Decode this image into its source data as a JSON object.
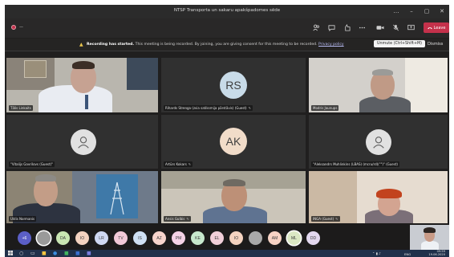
{
  "window": {
    "title": "NTSP Transporta un sakaru apakšpadomes sēde",
    "controls": [
      "…",
      "–",
      "▢",
      "✕"
    ]
  },
  "toolbar": {
    "timer": "—",
    "leave_label": "Leave"
  },
  "banner": {
    "bold_text": "Recording has started.",
    "message": "This meeting is being recorded. By joining, you are giving consent for this meeting to be recorded.",
    "policy_link": "Privacy policy",
    "dismiss_label": "Dismiss"
  },
  "tooltip": {
    "text": "Unmute (Ctrl+Shift+M)"
  },
  "tiles": [
    {
      "name": "Tālis Linkaits",
      "type": "video"
    },
    {
      "name": "Rihards Strenga (zvia satiksmija pārstāvis) (Guest)",
      "type": "initials",
      "initials": "RS",
      "color": "#c8dbe8"
    },
    {
      "name": "Modris Jaunups",
      "type": "video"
    },
    {
      "name": "\"Vitalijs Gavrilovs (Guest)\"",
      "type": "generic"
    },
    {
      "name": "Artūrs Kokars",
      "type": "initials",
      "initials": "AK",
      "color": "#f1dcc9"
    },
    {
      "name": "\"Aleksandrs Muhlinkins (LBAS) (mcru/rd)(\"\")\" (Guest)",
      "type": "generic"
    },
    {
      "name": "Uldis Normanis",
      "type": "video"
    },
    {
      "name": "Ansis Gulbis",
      "type": "video"
    },
    {
      "name": "INGA (Guest)",
      "type": "video"
    }
  ],
  "participants": [
    {
      "label": "+6",
      "color": "#5b5fc7",
      "text_color": "#ffffff"
    },
    {
      "label": "",
      "color": "#9a9a9a",
      "selected": true
    },
    {
      "label": "DA",
      "color": "#c9e6b3"
    },
    {
      "label": "IO",
      "color": "#f4d3c0"
    },
    {
      "label": "LR",
      "color": "#cfd8f2"
    },
    {
      "label": "TV",
      "color": "#f2c9d8"
    },
    {
      "label": "IS",
      "color": "#cfe0f4"
    },
    {
      "label": "AZ",
      "color": "#f7d4cc"
    },
    {
      "label": "PM",
      "color": "#f4d2e6"
    },
    {
      "label": "KE",
      "color": "#c7e8cd"
    },
    {
      "label": "EL",
      "color": "#f1cfd9"
    },
    {
      "label": "IO",
      "color": "#f4d3c0"
    },
    {
      "label": "",
      "color": "#a9a9a9"
    },
    {
      "label": "AM",
      "color": "#f7d3c5"
    },
    {
      "label": "ML",
      "color": "#dbe8c4",
      "selected": true
    },
    {
      "label": "DD",
      "color": "#e3d8f0"
    }
  ],
  "taskbar": {
    "time": "09:59",
    "date": "19.06.2020",
    "lang": "ENG"
  }
}
